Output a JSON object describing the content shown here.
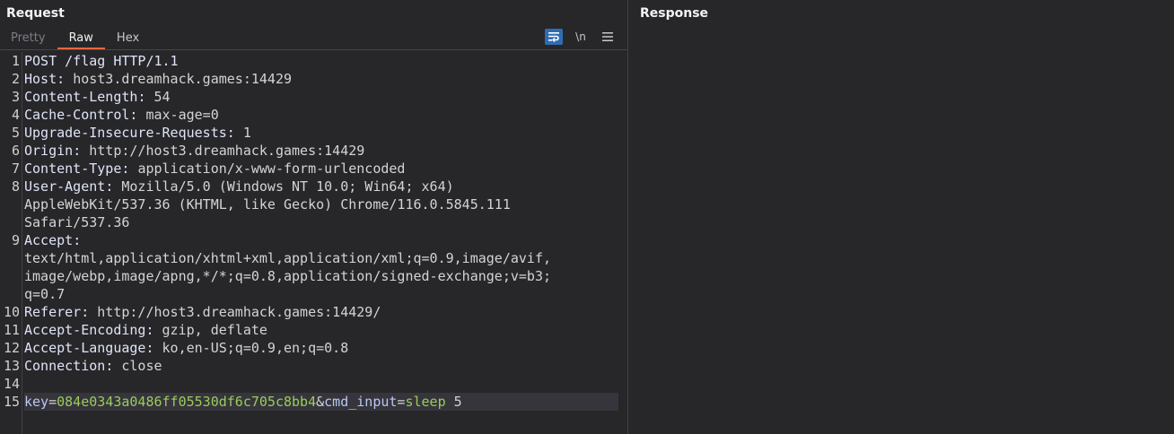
{
  "request": {
    "title": "Request",
    "tabs": [
      "Pretty",
      "Raw",
      "Hex"
    ],
    "active_tab": "Raw",
    "tools": {
      "wrap_icon": "wrap-icon",
      "newline_label": "\\n",
      "menu_icon": "menu-icon"
    },
    "lines": [
      {
        "n": "1",
        "key": "",
        "sep": "",
        "value": "POST /flag HTTP/1.1"
      },
      {
        "n": "2",
        "key": "Host",
        "sep": ": ",
        "value": "host3.dreamhack.games:14429"
      },
      {
        "n": "3",
        "key": "Content-Length",
        "sep": ": ",
        "value": "54"
      },
      {
        "n": "4",
        "key": "Cache-Control",
        "sep": ": ",
        "value": "max-age=0"
      },
      {
        "n": "5",
        "key": "Upgrade-Insecure-Requests",
        "sep": ": ",
        "value": "1"
      },
      {
        "n": "6",
        "key": "Origin",
        "sep": ": ",
        "value": "http://host3.dreamhack.games:14429"
      },
      {
        "n": "7",
        "key": "Content-Type",
        "sep": ": ",
        "value": "application/x-www-form-urlencoded"
      },
      {
        "n": "8",
        "key": "User-Agent",
        "sep": ": ",
        "value": "Mozilla/5.0 (Windows NT 10.0; Win64; x64)"
      },
      {
        "n": "",
        "key": "",
        "sep": "",
        "value": "AppleWebKit/537.36 (KHTML, like Gecko) Chrome/116.0.5845.111"
      },
      {
        "n": "",
        "key": "",
        "sep": "",
        "value": "Safari/537.36"
      },
      {
        "n": "9",
        "key": "Accept",
        "sep": ":",
        "value": ""
      },
      {
        "n": "",
        "key": "",
        "sep": "",
        "value": "text/html,application/xhtml+xml,application/xml;q=0.9,image/avif,"
      },
      {
        "n": "",
        "key": "",
        "sep": "",
        "value": "image/webp,image/apng,*/*;q=0.8,application/signed-exchange;v=b3;"
      },
      {
        "n": "",
        "key": "",
        "sep": "",
        "value": "q=0.7"
      },
      {
        "n": "10",
        "key": "Referer",
        "sep": ": ",
        "value": "http://host3.dreamhack.games:14429/"
      },
      {
        "n": "11",
        "key": "Accept-Encoding",
        "sep": ": ",
        "value": "gzip, deflate"
      },
      {
        "n": "12",
        "key": "Accept-Language",
        "sep": ": ",
        "value": "ko,en-US;q=0.9,en;q=0.8"
      },
      {
        "n": "13",
        "key": "Connection",
        "sep": ": ",
        "value": "close"
      },
      {
        "n": "14",
        "key": "",
        "sep": "",
        "value": ""
      }
    ],
    "body_line": {
      "n": "15",
      "k1": "key",
      "eq1": "=",
      "v1": "084e0343a0486ff05530df6c705c8bb4",
      "amp": "&",
      "k2": "cmd_input",
      "eq2": "=",
      "v2a": "sleep",
      "v2b": " 5"
    }
  },
  "response": {
    "title": "Response"
  },
  "colors": {
    "accent": "#e6683e",
    "header_key": "#dfe3f7",
    "param_value": "#9ccb5d",
    "param_key": "#bcc6f5"
  }
}
